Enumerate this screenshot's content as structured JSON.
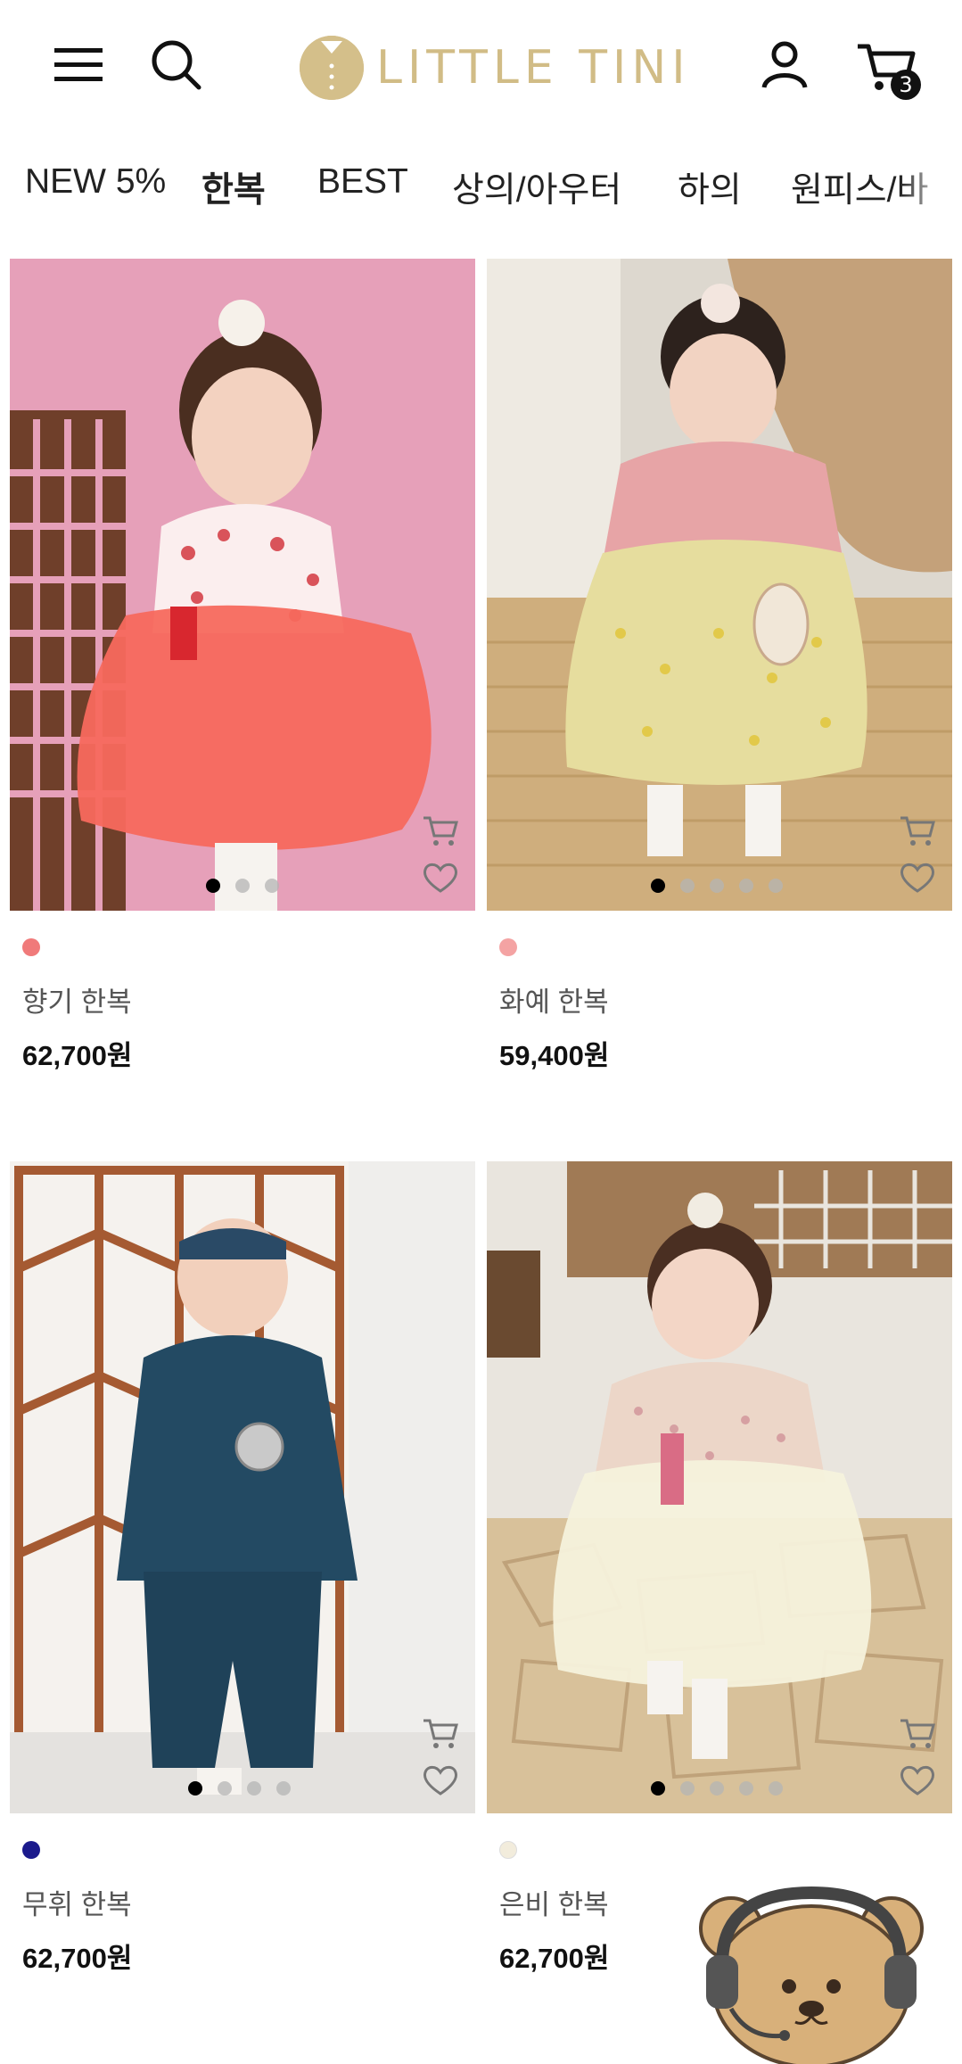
{
  "header": {
    "logo_text": "LITTLE TINI",
    "cart_count": "3",
    "icons": [
      "menu-icon",
      "search-icon",
      "user-icon",
      "cart-icon"
    ]
  },
  "categories": [
    {
      "label": "NEW 5%",
      "active": false
    },
    {
      "label": "한복",
      "active": true
    },
    {
      "label": "BEST",
      "active": false
    },
    {
      "label": "상의/아우터",
      "active": false
    },
    {
      "label": "하의",
      "active": false
    },
    {
      "label": "원피스/바",
      "active": false
    }
  ],
  "products": [
    {
      "name": "향기 한복",
      "price": "62,700원",
      "swatch_color": "#f07a7a",
      "slide_count": 3,
      "active_slide": 1
    },
    {
      "name": "화예 한복",
      "price": "59,400원",
      "swatch_color": "#f4a3a3",
      "slide_count": 5,
      "active_slide": 1
    },
    {
      "name": "무휘 한복",
      "price": "62,700원",
      "swatch_color": "#1b1a8c",
      "slide_count": 4,
      "active_slide": 1
    },
    {
      "name": "은비 한복",
      "price": "62,700원",
      "swatch_color": "#f2ecdc",
      "slide_count": 5,
      "active_slide": 1
    }
  ],
  "product_icons": [
    "cart-icon",
    "heart-icon"
  ],
  "chat_widget": {
    "icon": "bear-headset-icon"
  }
}
